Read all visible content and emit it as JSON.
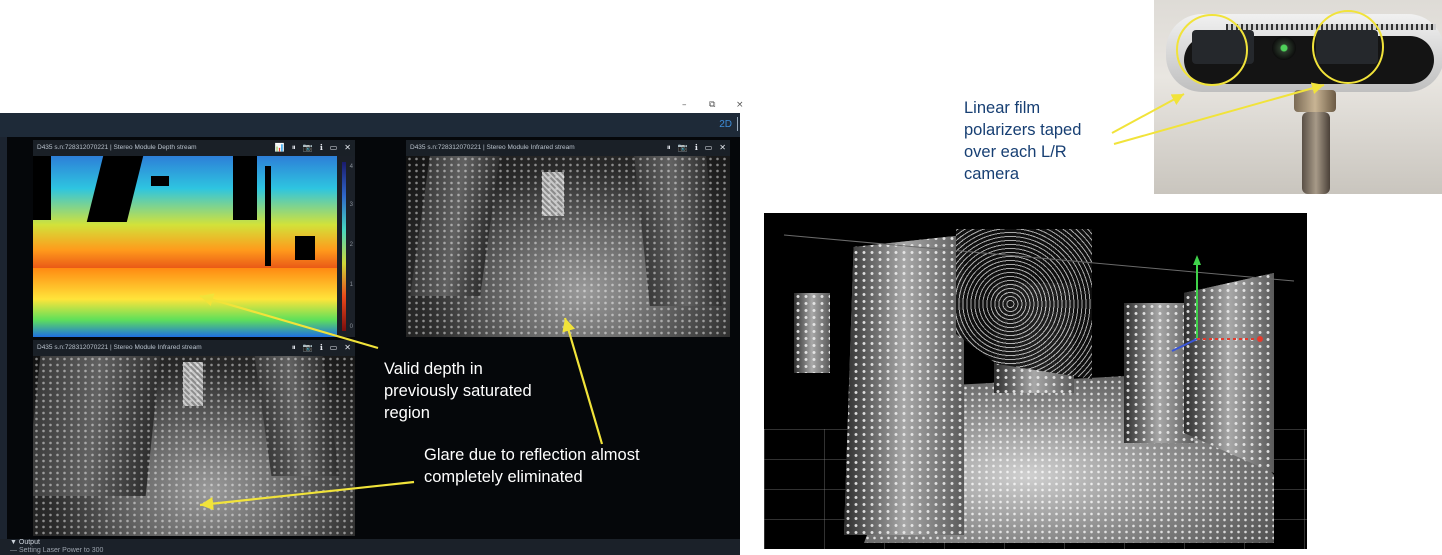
{
  "window": {
    "minimize_glyph": "–",
    "restore_glyph": "⧉",
    "close_glyph": "×"
  },
  "toolbar": {
    "zoom_value": "2D"
  },
  "depth_stream": {
    "title": "D435 s.n:728312070221 | Stereo Module Depth stream",
    "scale_ticks": [
      "4",
      "3",
      "2",
      "1",
      "0"
    ]
  },
  "ir_stream_right": {
    "title": "D435 s.n:728312070221 | Stereo Module Infrared stream"
  },
  "ir_stream_bottom": {
    "title": "D435 s.n:728312070221 | Stereo Module Infrared stream"
  },
  "stream_controls": {
    "chart": "📊",
    "pause": "⏸",
    "snapshot": "📷",
    "info": "ℹ",
    "maximize": "▭",
    "close": "✕"
  },
  "output": {
    "label": "Output",
    "message": "Setting Laser Power to 300",
    "toggle_glyph": "▼",
    "bullet_glyph": "—"
  },
  "annotations": {
    "valid_depth": [
      "Valid depth in",
      "previously saturated",
      "region"
    ],
    "glare": [
      "Glare due to reflection almost",
      "completely eliminated"
    ],
    "polarizers": [
      "Linear film",
      "polarizers taped",
      "over each L/R",
      "camera"
    ]
  },
  "colors": {
    "annotation_blue": "#173f73",
    "arrow_yellow": "#f1e33a",
    "accent_blue": "#3d8bd6"
  }
}
